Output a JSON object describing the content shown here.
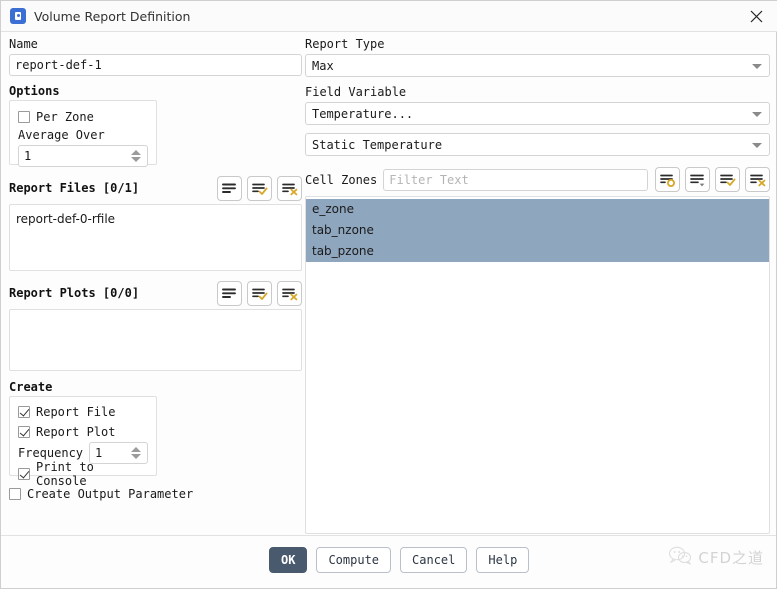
{
  "window": {
    "title": "Volume Report Definition",
    "app_icon": "fluent-app-icon",
    "close_icon": "close-icon"
  },
  "left": {
    "name_label": "Name",
    "name_value": "report-def-1",
    "options_label": "Options",
    "per_zone_label": "Per Zone",
    "per_zone_checked": false,
    "average_over_label": "Average Over",
    "average_over_value": "1",
    "report_files_label": "Report Files [0/1]",
    "report_files_items": [
      "report-def-0-rfile"
    ],
    "report_plots_label": "Report Plots [0/0]",
    "report_plots_items": [],
    "create_label": "Create",
    "report_file_label": "Report File",
    "report_file_checked": true,
    "report_plot_label": "Report Plot",
    "report_plot_checked": true,
    "frequency_label": "Frequency",
    "frequency_value": "1",
    "print_console_label": "Print to Console",
    "print_console_checked": true,
    "output_param_label": "Create Output Parameter",
    "output_param_checked": false,
    "list_icons": [
      "list-icon",
      "list-check-icon",
      "list-delete-icon"
    ]
  },
  "right": {
    "report_type_label": "Report Type",
    "report_type_value": "Max",
    "field_variable_label": "Field Variable",
    "field_variable_value": "Temperature...",
    "field_variable_sub_value": "Static Temperature",
    "cell_zones_label": "Cell Zones",
    "filter_placeholder": "Filter Text",
    "filter_value": "",
    "cell_zone_items": [
      "e_zone",
      "tab_nzone",
      "tab_pzone"
    ],
    "selection_color": "#8fa6bf",
    "zone_icons": [
      "list-select-icon",
      "list-dropdown-icon",
      "list-check-icon",
      "list-delete-icon"
    ]
  },
  "footer": {
    "ok_label": "OK",
    "compute_label": "Compute",
    "cancel_label": "Cancel",
    "help_label": "Help",
    "watermark_text": "CFD之道",
    "watermark_icon": "wechat-logo-icon"
  }
}
